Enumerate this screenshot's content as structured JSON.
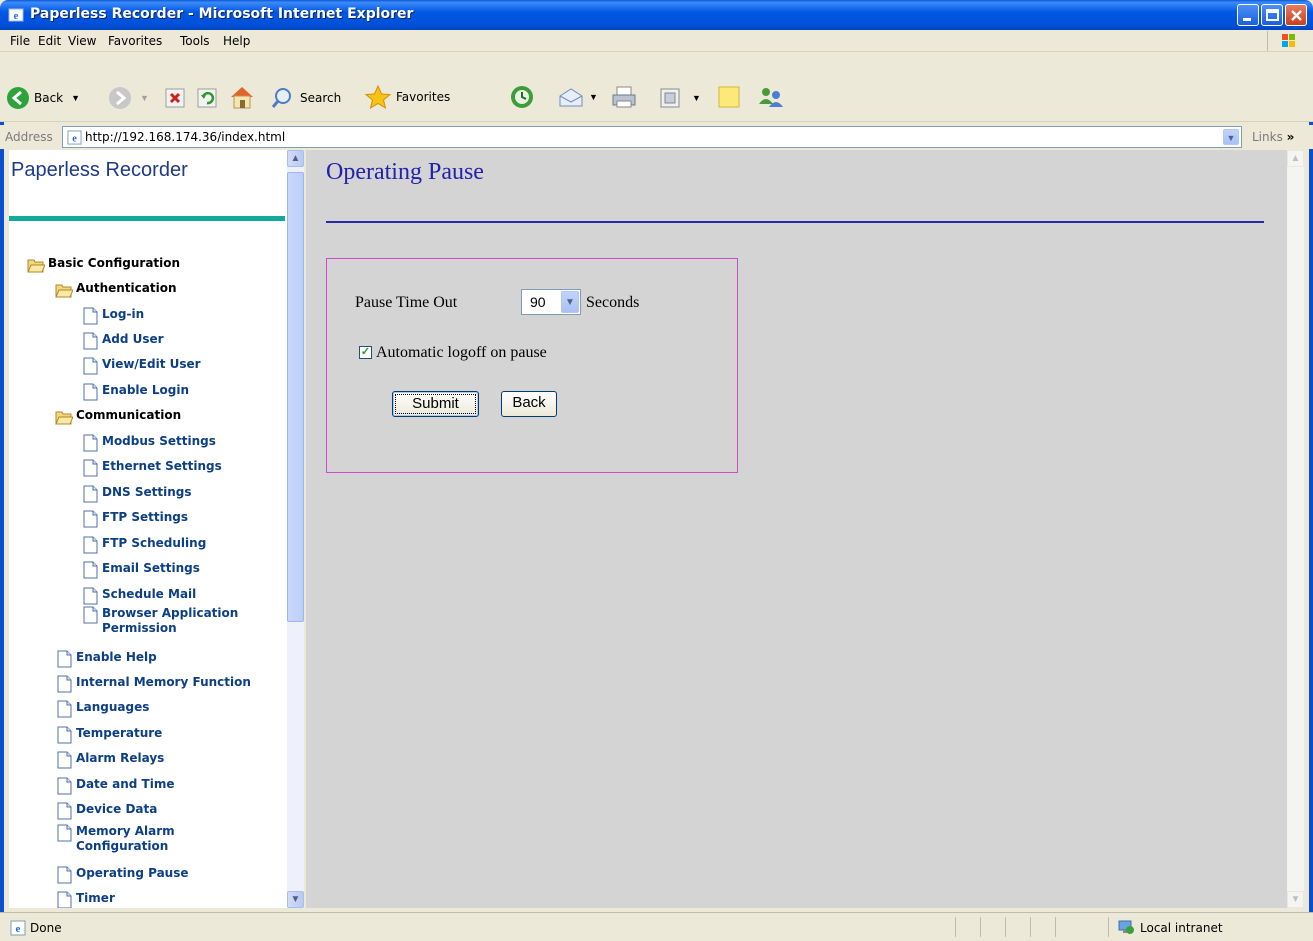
{
  "window": {
    "title": "Paperless Recorder - Microsoft Internet Explorer"
  },
  "menu": {
    "items": [
      "File",
      "Edit",
      "View",
      "Favorites",
      "Tools",
      "Help"
    ]
  },
  "toolbar": {
    "back_label": "Back",
    "search_label": "Search",
    "favorites_label": "Favorites"
  },
  "address": {
    "label": "Address",
    "url": "http://192.168.174.36/index.html",
    "links_label": "Links"
  },
  "sidebar": {
    "title": "Paperless Recorder",
    "items": [
      {
        "label": "Basic Configuration",
        "type": "folder",
        "level": 0
      },
      {
        "label": "Authentication",
        "type": "folder",
        "level": 1
      },
      {
        "label": "Log-in",
        "type": "page",
        "level": 2
      },
      {
        "label": "Add User",
        "type": "page",
        "level": 2
      },
      {
        "label": "View/Edit User",
        "type": "page",
        "level": 2
      },
      {
        "label": "Enable Login",
        "type": "page",
        "level": 2
      },
      {
        "label": "Communication",
        "type": "folder",
        "level": 1
      },
      {
        "label": "Modbus Settings",
        "type": "page",
        "level": 2
      },
      {
        "label": "Ethernet Settings",
        "type": "page",
        "level": 2
      },
      {
        "label": "DNS Settings",
        "type": "page",
        "level": 2
      },
      {
        "label": "FTP Settings",
        "type": "page",
        "level": 2
      },
      {
        "label": "FTP Scheduling",
        "type": "page",
        "level": 2
      },
      {
        "label": "Email Settings",
        "type": "page",
        "level": 2
      },
      {
        "label": "Schedule Mail",
        "type": "page",
        "level": 2
      },
      {
        "label": "Browser Application Permission",
        "type": "page",
        "level": 2
      },
      {
        "label": "Enable Help",
        "type": "page",
        "level": 1
      },
      {
        "label": "Internal Memory Function",
        "type": "page",
        "level": 1
      },
      {
        "label": "Languages",
        "type": "page",
        "level": 1
      },
      {
        "label": "Temperature",
        "type": "page",
        "level": 1
      },
      {
        "label": "Alarm Relays",
        "type": "page",
        "level": 1
      },
      {
        "label": "Date and Time",
        "type": "page",
        "level": 1
      },
      {
        "label": "Device Data",
        "type": "page",
        "level": 1
      },
      {
        "label": "Memory Alarm Configuration",
        "type": "page",
        "level": 1
      },
      {
        "label": "Operating Pause",
        "type": "page",
        "level": 1
      },
      {
        "label": "Timer",
        "type": "page",
        "level": 1
      }
    ]
  },
  "main": {
    "title": "Operating Pause",
    "form": {
      "pause_label": "Pause Time Out",
      "pause_value": "90",
      "pause_unit": "Seconds",
      "auto_logoff_label": "Automatic logoff on pause",
      "auto_logoff_checked": true,
      "submit_label": "Submit",
      "back_label": "Back"
    }
  },
  "status": {
    "text": "Done",
    "zone": "Local intranet"
  },
  "colors": {
    "title_bar": "#0058e6",
    "sidebar_title": "#1f3a85",
    "sidebar_rule": "#12a89a",
    "page_title": "#2222aa",
    "form_border": "#cc4ccc",
    "content_bg": "#d4d4d4",
    "nav_link": "#0d3f85"
  }
}
